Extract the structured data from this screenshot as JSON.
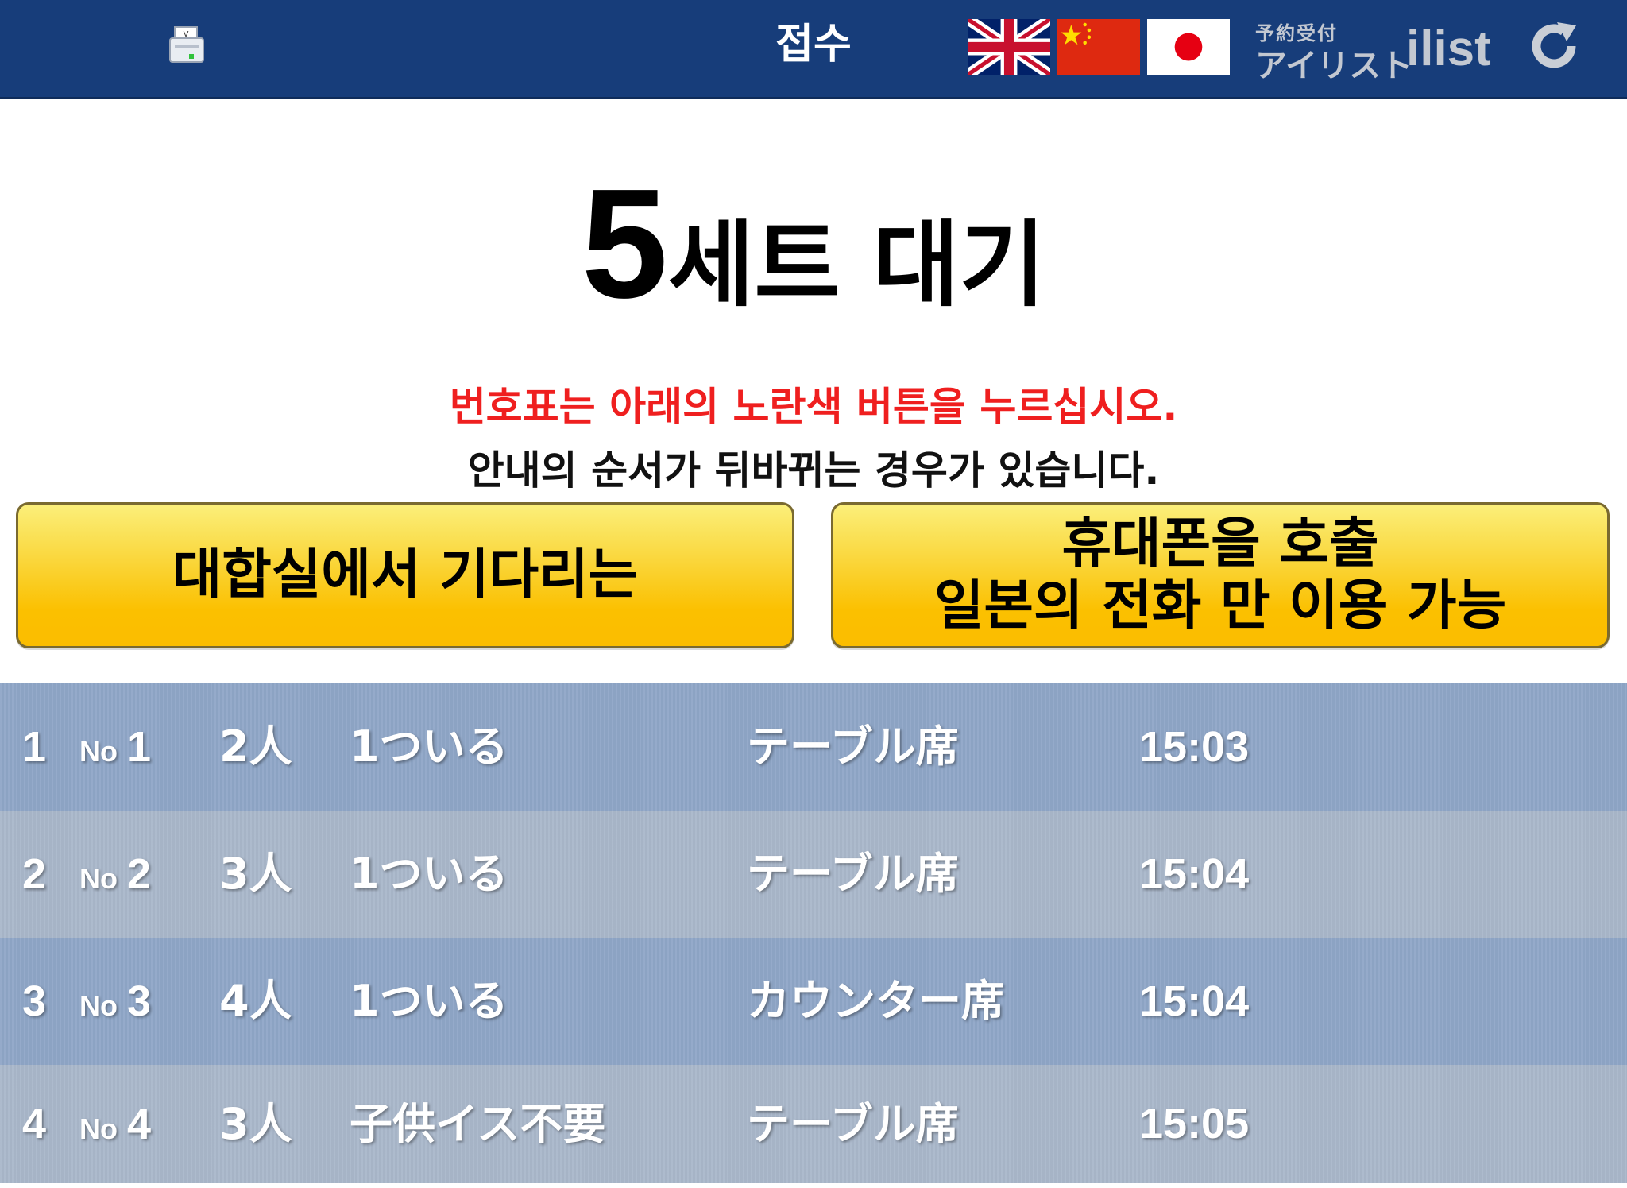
{
  "header": {
    "title": "접수",
    "flags": [
      "uk-flag",
      "china-flag",
      "japan-flag"
    ],
    "brand_small": "予約受付",
    "brand_kana": "アイリスト",
    "brand_mark": "ilist",
    "icons": [
      "printer-icon",
      "refresh-icon"
    ]
  },
  "wait": {
    "number": "5",
    "label": "세트 대기"
  },
  "notices": {
    "red": "번호표는 아래의 노란색 버튼을 누르십시오.",
    "black": "안내의 순서가 뒤바뀌는 경우가 있습니다."
  },
  "buttons": {
    "wait_room": "대합실에서 기다리는",
    "phone_line1": "휴대폰을 호출",
    "phone_line2": "일본의 전화 만 이용 가능"
  },
  "queue": {
    "no_label": "No",
    "rows": [
      {
        "index": "1",
        "no": "1",
        "people": "2人",
        "note": "1ついる",
        "seat": "テーブル席",
        "time": "15:03"
      },
      {
        "index": "2",
        "no": "2",
        "people": "3人",
        "note": "1ついる",
        "seat": "テーブル席",
        "time": "15:04"
      },
      {
        "index": "3",
        "no": "3",
        "people": "4人",
        "note": "1ついる",
        "seat": "カウンター席",
        "time": "15:04"
      },
      {
        "index": "4",
        "no": "4",
        "people": "3人",
        "note": "子供イス不要",
        "seat": "テーブル席",
        "time": "15:05"
      }
    ]
  },
  "colors": {
    "header_bg": "#173d7a",
    "notice_red": "#ef1f1f",
    "button_yellow": "#fbc000",
    "row_dark": "#8fa6c7",
    "row_light": "#a9b7ca"
  }
}
